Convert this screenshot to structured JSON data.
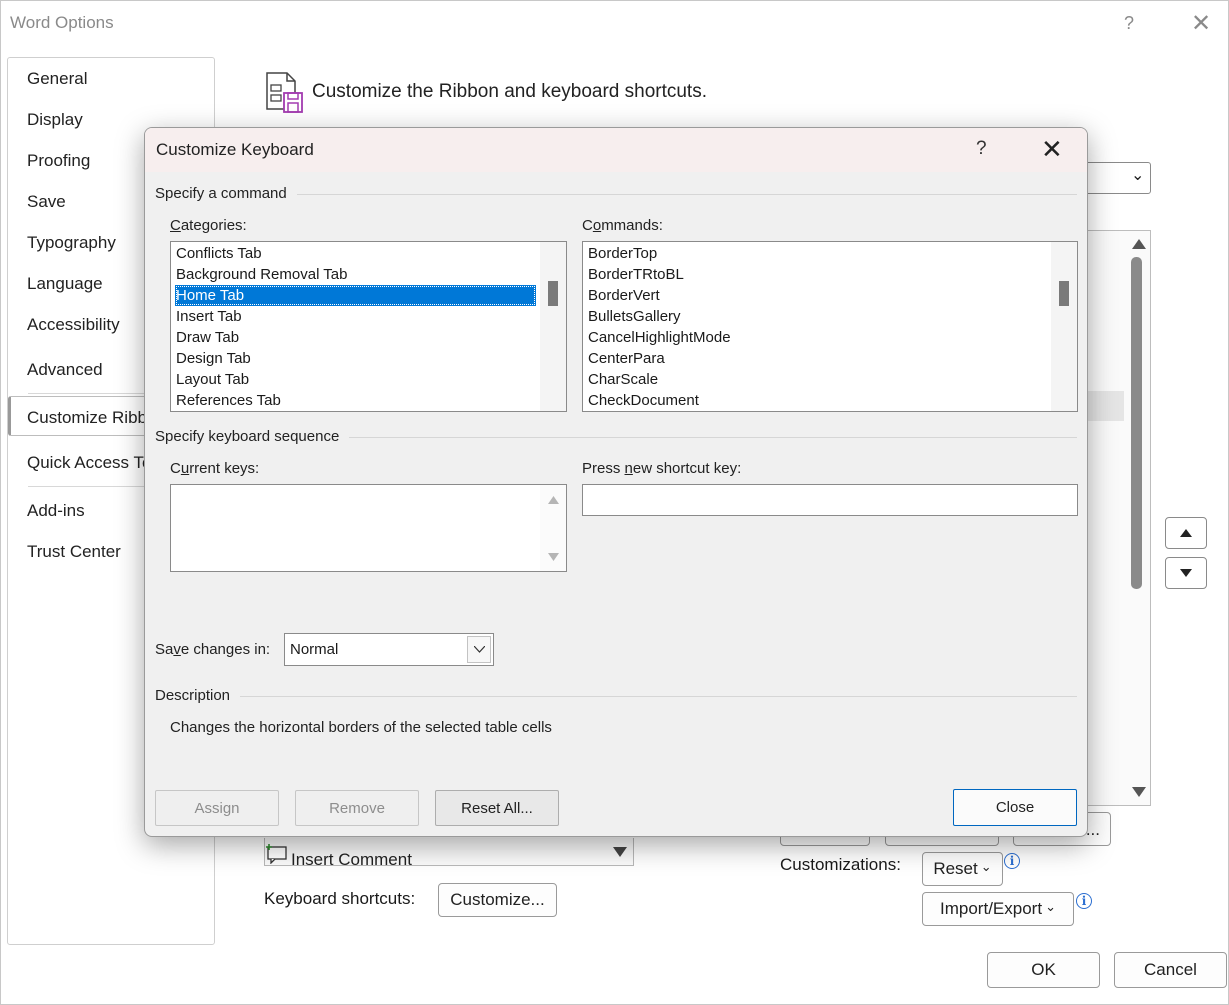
{
  "outer_window": {
    "title": "Word Options",
    "help_glyph": "?",
    "close_glyph": "✕",
    "nav_items": [
      "General",
      "Display",
      "Proofing",
      "Save",
      "Typography",
      "Language",
      "Accessibility",
      "Advanced",
      "Customize Ribb",
      "Quick Access To",
      "Add-ins",
      "Trust Center"
    ],
    "selected_nav": "Customize Ribb",
    "header_text": "Customize the Ribbon and keyboard shortcuts.",
    "insert_comment_label": "Insert Comment",
    "keyboard_shortcuts_label": "Keyboard shortcuts:",
    "customize_button": "Customize...",
    "customizations_label": "Customizations:",
    "reset_button": "Reset",
    "import_export_button": "Import/Export",
    "ok_button": "OK",
    "cancel_button": "Cancel",
    "info_glyph": "i",
    "dropdown_glyph": "⌄"
  },
  "dialog": {
    "title": "Customize Keyboard",
    "help_glyph": "?",
    "close_glyph": "✕",
    "specify_command_label": "Specify a command",
    "categories_label": "Categories:",
    "categories": [
      "Conflicts Tab",
      "Background Removal Tab",
      "Home Tab",
      "Insert Tab",
      "Draw Tab",
      "Design Tab",
      "Layout Tab",
      "References Tab"
    ],
    "selected_category": "Home Tab",
    "commands_label": "Commands:",
    "commands": [
      "BorderTop",
      "BorderTRtoBL",
      "BorderVert",
      "BulletsGallery",
      "CancelHighlightMode",
      "CenterPara",
      "CharScale",
      "CheckDocument"
    ],
    "specify_sequence_label": "Specify keyboard sequence",
    "current_keys_label": "Current keys:",
    "current_keys_value": "",
    "new_shortcut_label": "Press new shortcut key:",
    "new_shortcut_value": "",
    "save_changes_label": "Save changes in:",
    "save_changes_value": "Normal",
    "description_label": "Description",
    "description_text": "Changes the horizontal borders of the selected table cells",
    "assign_button": "Assign",
    "remove_button": "Remove",
    "reset_all_button": "Reset All...",
    "close_button": "Close"
  },
  "colors": {
    "selection": "#0078d7",
    "dialog_title_bg": "#f7eeee",
    "dialog_bg": "#f0f0f0",
    "accent_border": "#0067c0"
  }
}
